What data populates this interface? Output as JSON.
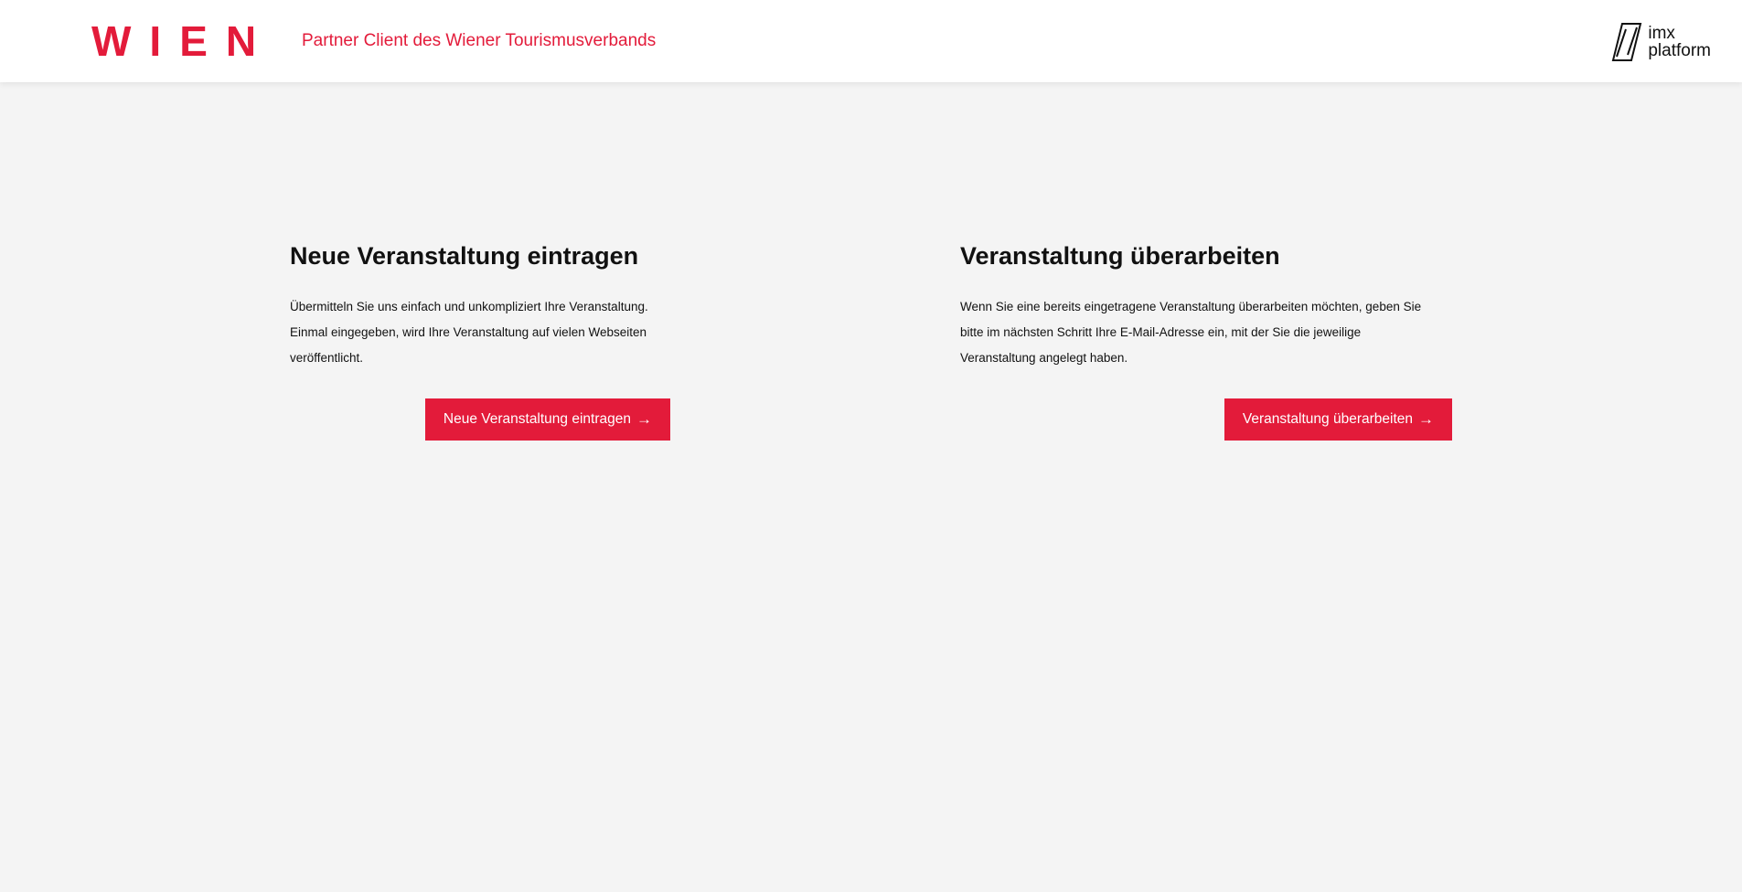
{
  "header": {
    "logo": "WIEN",
    "tagline": "Partner Client des Wiener Tourismusverbands",
    "platform_logo": {
      "line1": "imx",
      "line2": "platform",
      "icon": "imx-platform-logo-icon"
    }
  },
  "cards": {
    "new_event": {
      "title": "Neue Veranstaltung eintragen",
      "line1": "Übermitteln Sie uns einfach und unkompliziert Ihre Veranstaltung.",
      "line2": "Einmal eingegeben, wird Ihre Veranstaltung auf vielen Webseiten",
      "line3": "veröffentlicht.",
      "button_label": "Neue Veranstaltung eintragen",
      "button_icon": "→"
    },
    "edit_event": {
      "title": "Veranstaltung überarbeiten",
      "line1": "Wenn Sie eine bereits eingetragene Veranstaltung überarbeiten möchten, geben Sie",
      "line2": "bitte im nächsten Schritt Ihre E-Mail-Adresse ein, mit der Sie die jeweilige",
      "line3": "Veranstaltung angelegt haben.",
      "button_label": "Veranstaltung überarbeiten",
      "button_icon": "→"
    }
  },
  "colors": {
    "accent": "#e31b3a",
    "background": "#f4f4f4",
    "header_background": "#ffffff",
    "text": "#111111"
  }
}
